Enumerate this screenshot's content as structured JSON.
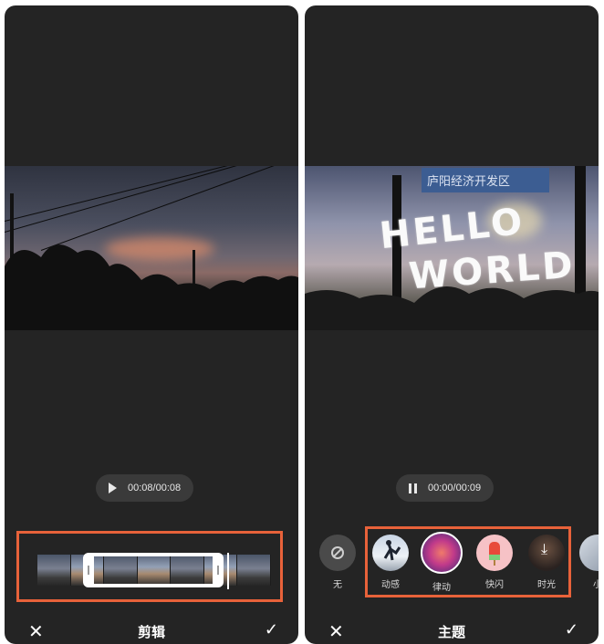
{
  "left_panel": {
    "playback": {
      "time": "00:08/00:08",
      "state": "paused"
    },
    "bottom_bar": {
      "title": "剪辑",
      "close_icon": "✕",
      "confirm_icon": "✓"
    }
  },
  "right_panel": {
    "overlay_text": {
      "line1": "HELLO",
      "line2": "WORLD"
    },
    "sign_text": "庐阳经济开发区",
    "playback": {
      "time": "00:00/00:09",
      "state": "playing"
    },
    "themes": [
      {
        "label": "无",
        "icon": "none-icon"
      },
      {
        "label": "动感",
        "icon": "dynamic-thumb"
      },
      {
        "label": "律动",
        "icon": "rhythm-thumb",
        "selected": true
      },
      {
        "label": "快闪",
        "icon": "flash-thumb"
      },
      {
        "label": "时光",
        "icon": "download-icon"
      },
      {
        "label": "小",
        "icon": "partial-thumb"
      }
    ],
    "bottom_bar": {
      "title": "主题",
      "close_icon": "✕",
      "confirm_icon": "✓"
    }
  },
  "colors": {
    "panel_bg": "#242424",
    "highlight": "#e8623a",
    "text": "#ffffff"
  }
}
